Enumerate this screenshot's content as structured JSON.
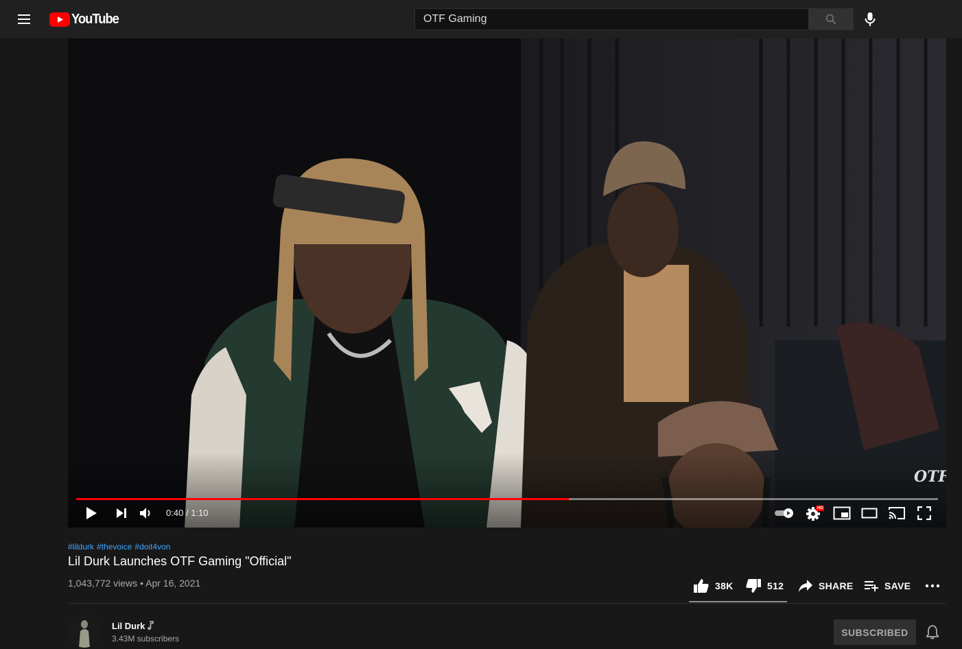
{
  "masthead": {
    "logo_text": "YouTube",
    "search_value": "OTF Gaming",
    "icons": [
      "menu-icon",
      "youtube-logo",
      "search-icon",
      "microphone-icon"
    ]
  },
  "player": {
    "time_current": "0:40",
    "time_separator": "/",
    "time_total": "1:10",
    "progress_fraction": 0.572,
    "watermark": "OTF",
    "controls": [
      "play-icon",
      "next-icon",
      "volume-icon",
      "autoplay-toggle",
      "settings-icon",
      "miniplayer-icon",
      "theater-icon",
      "cast-icon",
      "fullscreen-icon"
    ],
    "settings_badge": "HD",
    "accent_color": "#ff0000"
  },
  "video": {
    "hashtags": [
      "#lildurk",
      "#thevoice",
      "#doit4von"
    ],
    "title": "Lil Durk Launches OTF Gaming \"Official\"",
    "views": "1,043,772 views",
    "meta_separator": "•",
    "date": "Apr 16, 2021",
    "likes": "38K",
    "dislikes": "512",
    "share_label": "SHARE",
    "save_label": "SAVE"
  },
  "channel": {
    "name": "Lil Durk",
    "subscribers": "3.43M subscribers",
    "subscribe_label": "SUBSCRIBED"
  }
}
